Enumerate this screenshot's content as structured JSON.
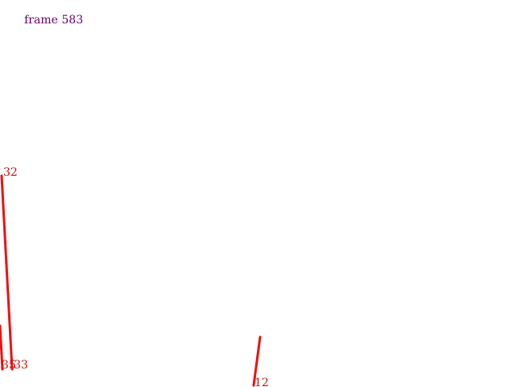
{
  "frame": {
    "label": "frame 583"
  },
  "colors": {
    "frame_label": "#660066",
    "segment": "#ee1111",
    "segment_label": "#cc1111",
    "background": "#ffffff"
  },
  "segments": [
    {
      "id": "32",
      "label": "32"
    },
    {
      "id": "35",
      "label": "35"
    },
    {
      "id": "33",
      "label": "33"
    },
    {
      "id": "12",
      "label": "12"
    }
  ]
}
